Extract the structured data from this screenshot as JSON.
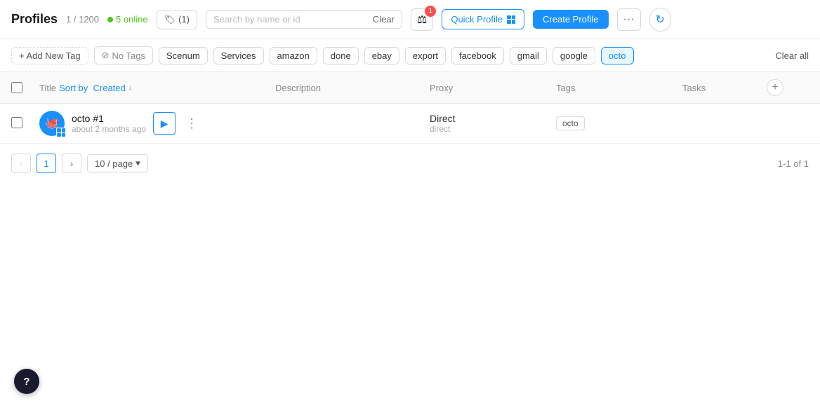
{
  "header": {
    "title": "Profiles",
    "count": "1 / 1200",
    "online_label": "5 online",
    "tag_count": "(1)",
    "search_placeholder": "Search by name or id",
    "clear_label": "Clear",
    "filter_badge": "1",
    "quick_profile_label": "Quick Profile",
    "create_profile_label": "Create Profile"
  },
  "tags_bar": {
    "add_tag_label": "+ Add New Tag",
    "tags": [
      {
        "label": "No Tags",
        "active": false,
        "no_tags": true
      },
      {
        "label": "Scenum",
        "active": false
      },
      {
        "label": "Services",
        "active": false
      },
      {
        "label": "amazon",
        "active": false
      },
      {
        "label": "done",
        "active": false
      },
      {
        "label": "ebay",
        "active": false
      },
      {
        "label": "export",
        "active": false
      },
      {
        "label": "facebook",
        "active": false
      },
      {
        "label": "gmail",
        "active": false
      },
      {
        "label": "google",
        "active": false
      },
      {
        "label": "octo",
        "active": true
      }
    ],
    "clear_all_label": "Clear all"
  },
  "table": {
    "headers": {
      "title": "Title",
      "sort_label": "Sort by",
      "sort_field": "Created",
      "description": "Description",
      "proxy": "Proxy",
      "tags": "Tags",
      "tasks": "Tasks"
    },
    "rows": [
      {
        "name": "octo #1",
        "time": "about 2 months ago",
        "description": "",
        "proxy_main": "Direct",
        "proxy_sub": "direct",
        "tag": "octo"
      }
    ],
    "pagination": {
      "current_page": "1",
      "per_page": "10 / page",
      "info": "1-1 of 1"
    }
  },
  "help": {
    "label": "?"
  }
}
